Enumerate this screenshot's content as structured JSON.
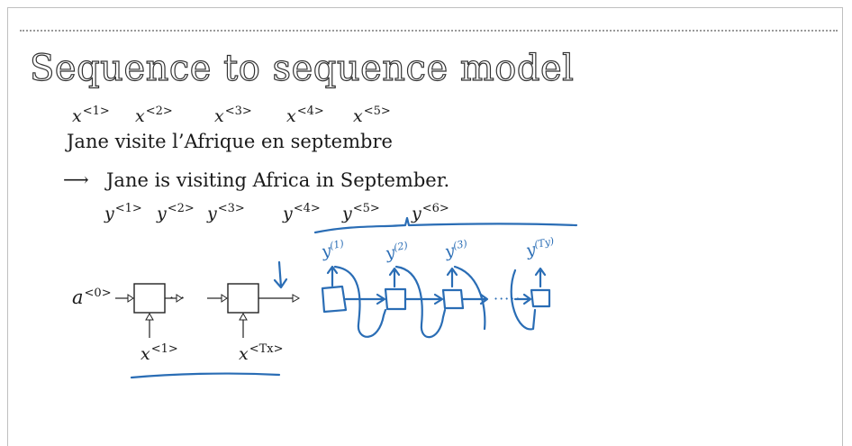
{
  "slide": {
    "title": "Sequence to sequence model"
  },
  "source": {
    "labels": [
      {
        "base": "x",
        "sup": "<1>"
      },
      {
        "base": "x",
        "sup": "<2>"
      },
      {
        "base": "x",
        "sup": "<3>"
      },
      {
        "base": "x",
        "sup": "<4>"
      },
      {
        "base": "x",
        "sup": "<5>"
      }
    ],
    "sentence": "Jane visite l’Afrique en septembre"
  },
  "target": {
    "arrow": "⟶",
    "sentence": "Jane is visiting Africa in September.",
    "labels": [
      {
        "base": "y",
        "sup": "<1>"
      },
      {
        "base": "y",
        "sup": "<2>"
      },
      {
        "base": "y",
        "sup": "<3>"
      },
      {
        "base": "y",
        "sup": "<4>"
      },
      {
        "base": "y",
        "sup": "<5>"
      },
      {
        "base": "y",
        "sup": "<6>"
      }
    ]
  },
  "encoder": {
    "initial_state": {
      "base": "a",
      "sup": "<0>"
    },
    "ellipsis": "···",
    "inputs": [
      {
        "base": "x",
        "sup": "<1>"
      },
      {
        "base": "x",
        "sup": "<Tx>"
      }
    ]
  },
  "decoder_annotation": {
    "outputs": [
      {
        "base": "y",
        "sup": "(1)"
      },
      {
        "base": "y",
        "sup": "(2)"
      },
      {
        "base": "y",
        "sup": "(3)"
      },
      {
        "base": "y",
        "sup": "(Ty)"
      }
    ],
    "ellipsis": "·····"
  },
  "colors": {
    "ink_blue": "#2a6db5",
    "text": "#1a1a1a"
  }
}
